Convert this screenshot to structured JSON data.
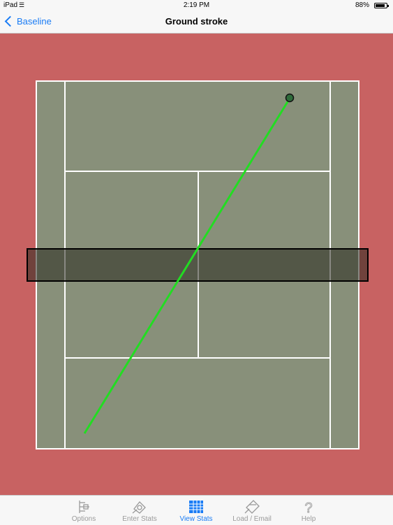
{
  "status": {
    "carrier": "iPad",
    "wifi_icon": "wifi-icon",
    "time": "2:19 PM",
    "battery": "88%",
    "battery_level": 0.88
  },
  "nav": {
    "back_label": "Baseline",
    "title": "Ground stroke"
  },
  "court": {
    "surround_color": "#c86262",
    "court_color": "#88907a",
    "line_color": "#ffffff",
    "net_color": "#000000",
    "shot_color": "#22dd22",
    "ball_color": "#2e6b3a"
  },
  "tabs": [
    {
      "label": "Options",
      "icon": "options-icon",
      "active": false
    },
    {
      "label": "Enter Stats",
      "icon": "enter-stats-icon",
      "active": false
    },
    {
      "label": "View Stats",
      "icon": "view-stats-icon",
      "active": true
    },
    {
      "label": "Load / Email",
      "icon": "load-email-icon",
      "active": false
    },
    {
      "label": "Help",
      "icon": "help-icon",
      "active": false
    }
  ]
}
